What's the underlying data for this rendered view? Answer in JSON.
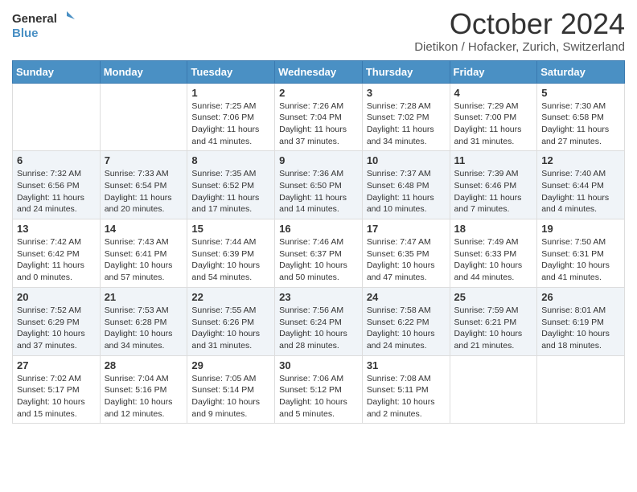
{
  "header": {
    "logo_line1": "General",
    "logo_line2": "Blue",
    "month_title": "October 2024",
    "location": "Dietikon / Hofacker, Zurich, Switzerland"
  },
  "days_of_week": [
    "Sunday",
    "Monday",
    "Tuesday",
    "Wednesday",
    "Thursday",
    "Friday",
    "Saturday"
  ],
  "weeks": [
    [
      {
        "day": "",
        "info": ""
      },
      {
        "day": "",
        "info": ""
      },
      {
        "day": "1",
        "info": "Sunrise: 7:25 AM\nSunset: 7:06 PM\nDaylight: 11 hours and 41 minutes."
      },
      {
        "day": "2",
        "info": "Sunrise: 7:26 AM\nSunset: 7:04 PM\nDaylight: 11 hours and 37 minutes."
      },
      {
        "day": "3",
        "info": "Sunrise: 7:28 AM\nSunset: 7:02 PM\nDaylight: 11 hours and 34 minutes."
      },
      {
        "day": "4",
        "info": "Sunrise: 7:29 AM\nSunset: 7:00 PM\nDaylight: 11 hours and 31 minutes."
      },
      {
        "day": "5",
        "info": "Sunrise: 7:30 AM\nSunset: 6:58 PM\nDaylight: 11 hours and 27 minutes."
      }
    ],
    [
      {
        "day": "6",
        "info": "Sunrise: 7:32 AM\nSunset: 6:56 PM\nDaylight: 11 hours and 24 minutes."
      },
      {
        "day": "7",
        "info": "Sunrise: 7:33 AM\nSunset: 6:54 PM\nDaylight: 11 hours and 20 minutes."
      },
      {
        "day": "8",
        "info": "Sunrise: 7:35 AM\nSunset: 6:52 PM\nDaylight: 11 hours and 17 minutes."
      },
      {
        "day": "9",
        "info": "Sunrise: 7:36 AM\nSunset: 6:50 PM\nDaylight: 11 hours and 14 minutes."
      },
      {
        "day": "10",
        "info": "Sunrise: 7:37 AM\nSunset: 6:48 PM\nDaylight: 11 hours and 10 minutes."
      },
      {
        "day": "11",
        "info": "Sunrise: 7:39 AM\nSunset: 6:46 PM\nDaylight: 11 hours and 7 minutes."
      },
      {
        "day": "12",
        "info": "Sunrise: 7:40 AM\nSunset: 6:44 PM\nDaylight: 11 hours and 4 minutes."
      }
    ],
    [
      {
        "day": "13",
        "info": "Sunrise: 7:42 AM\nSunset: 6:42 PM\nDaylight: 11 hours and 0 minutes."
      },
      {
        "day": "14",
        "info": "Sunrise: 7:43 AM\nSunset: 6:41 PM\nDaylight: 10 hours and 57 minutes."
      },
      {
        "day": "15",
        "info": "Sunrise: 7:44 AM\nSunset: 6:39 PM\nDaylight: 10 hours and 54 minutes."
      },
      {
        "day": "16",
        "info": "Sunrise: 7:46 AM\nSunset: 6:37 PM\nDaylight: 10 hours and 50 minutes."
      },
      {
        "day": "17",
        "info": "Sunrise: 7:47 AM\nSunset: 6:35 PM\nDaylight: 10 hours and 47 minutes."
      },
      {
        "day": "18",
        "info": "Sunrise: 7:49 AM\nSunset: 6:33 PM\nDaylight: 10 hours and 44 minutes."
      },
      {
        "day": "19",
        "info": "Sunrise: 7:50 AM\nSunset: 6:31 PM\nDaylight: 10 hours and 41 minutes."
      }
    ],
    [
      {
        "day": "20",
        "info": "Sunrise: 7:52 AM\nSunset: 6:29 PM\nDaylight: 10 hours and 37 minutes."
      },
      {
        "day": "21",
        "info": "Sunrise: 7:53 AM\nSunset: 6:28 PM\nDaylight: 10 hours and 34 minutes."
      },
      {
        "day": "22",
        "info": "Sunrise: 7:55 AM\nSunset: 6:26 PM\nDaylight: 10 hours and 31 minutes."
      },
      {
        "day": "23",
        "info": "Sunrise: 7:56 AM\nSunset: 6:24 PM\nDaylight: 10 hours and 28 minutes."
      },
      {
        "day": "24",
        "info": "Sunrise: 7:58 AM\nSunset: 6:22 PM\nDaylight: 10 hours and 24 minutes."
      },
      {
        "day": "25",
        "info": "Sunrise: 7:59 AM\nSunset: 6:21 PM\nDaylight: 10 hours and 21 minutes."
      },
      {
        "day": "26",
        "info": "Sunrise: 8:01 AM\nSunset: 6:19 PM\nDaylight: 10 hours and 18 minutes."
      }
    ],
    [
      {
        "day": "27",
        "info": "Sunrise: 7:02 AM\nSunset: 5:17 PM\nDaylight: 10 hours and 15 minutes."
      },
      {
        "day": "28",
        "info": "Sunrise: 7:04 AM\nSunset: 5:16 PM\nDaylight: 10 hours and 12 minutes."
      },
      {
        "day": "29",
        "info": "Sunrise: 7:05 AM\nSunset: 5:14 PM\nDaylight: 10 hours and 9 minutes."
      },
      {
        "day": "30",
        "info": "Sunrise: 7:06 AM\nSunset: 5:12 PM\nDaylight: 10 hours and 5 minutes."
      },
      {
        "day": "31",
        "info": "Sunrise: 7:08 AM\nSunset: 5:11 PM\nDaylight: 10 hours and 2 minutes."
      },
      {
        "day": "",
        "info": ""
      },
      {
        "day": "",
        "info": ""
      }
    ]
  ]
}
